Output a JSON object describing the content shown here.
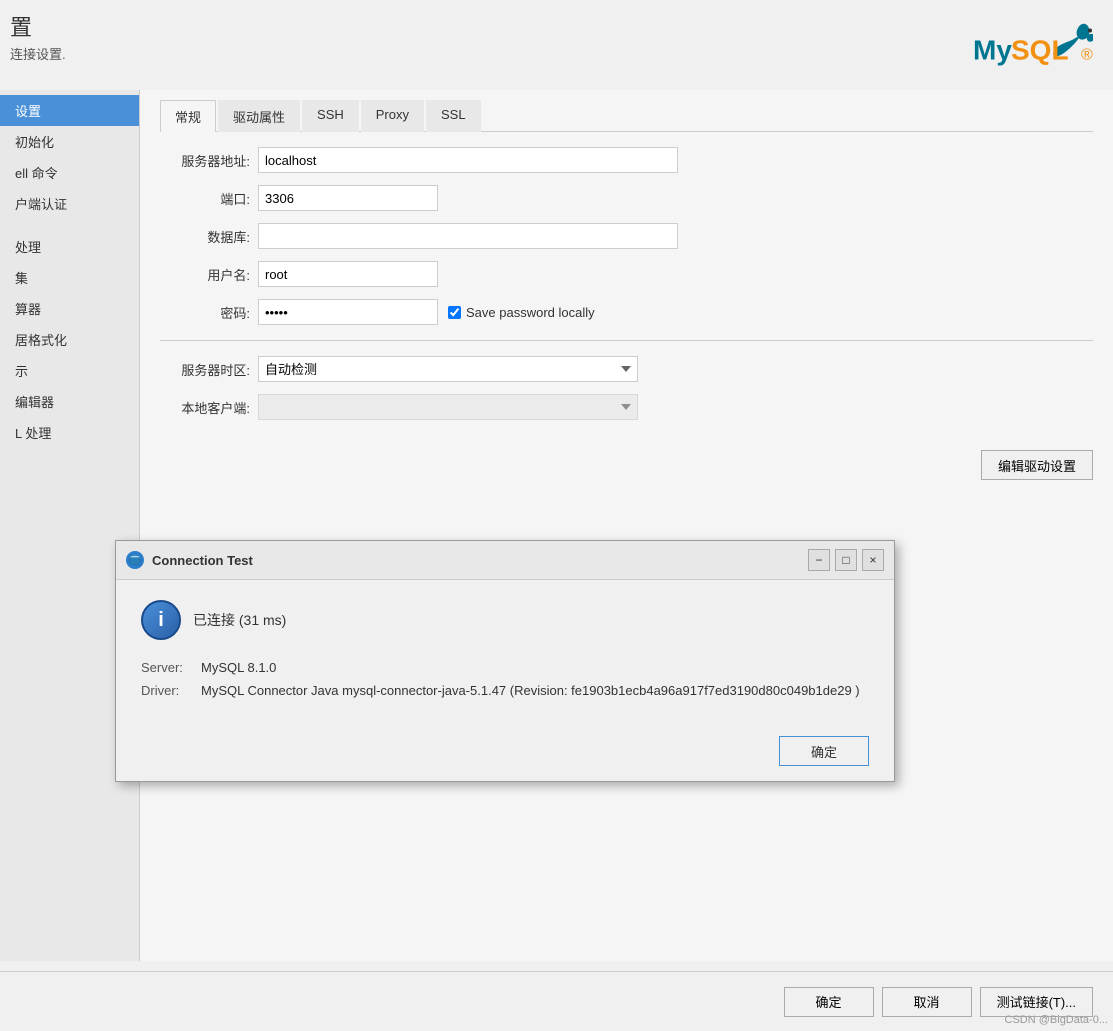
{
  "header": {
    "title": "置",
    "subtitle": "连接设置.",
    "logo_alt": "MySQL"
  },
  "sidebar": {
    "items": [
      {
        "label": "设置",
        "active": true
      },
      {
        "label": "初始化",
        "active": false
      },
      {
        "label": "ell 命令",
        "active": false
      },
      {
        "label": "户端认证",
        "active": false
      },
      {
        "label": "",
        "active": false
      },
      {
        "label": "处理",
        "active": false
      },
      {
        "label": "集",
        "active": false
      },
      {
        "label": "算器",
        "active": false
      },
      {
        "label": "居格式化",
        "active": false
      },
      {
        "label": "示",
        "active": false
      },
      {
        "label": "编辑器",
        "active": false
      },
      {
        "label": "L 处理",
        "active": false
      }
    ]
  },
  "tabs": [
    {
      "label": "常规",
      "active": true
    },
    {
      "label": "驱动属性",
      "active": false
    },
    {
      "label": "SSH",
      "active": false
    },
    {
      "label": "Proxy",
      "active": false
    },
    {
      "label": "SSL",
      "active": false
    }
  ],
  "form": {
    "server_label": "服务器地址:",
    "server_value": "localhost",
    "port_label": "端口:",
    "port_value": "3306",
    "database_label": "数据库:",
    "database_value": "",
    "username_label": "用户名:",
    "username_value": "root",
    "password_label": "密码:",
    "password_value": "●●●●●",
    "save_password_label": "Save password locally",
    "save_password_checked": true,
    "timezone_label": "服务器时区:",
    "timezone_value": "自动检测",
    "client_label": "本地客户端:",
    "client_value": ""
  },
  "buttons": {
    "ok_label": "确定",
    "cancel_label": "取消",
    "test_label": "测试链接(T)...",
    "edit_driver_label": "编辑驱动设置"
  },
  "dialog": {
    "title": "Connection Test",
    "minimize_label": "−",
    "maximize_label": "□",
    "close_label": "×",
    "status_text": "已连接 (31 ms)",
    "server_label": "Server:",
    "server_value": "MySQL 8.1.0",
    "driver_label": "Driver:",
    "driver_value": "MySQL Connector Java mysql-connector-java-5.1.47 (Revision: fe1903b1ecb4a96a917f7ed3190d80c049b1de29 )",
    "ok_button": "确定"
  },
  "watermark": "CSDN @BigData-0..."
}
